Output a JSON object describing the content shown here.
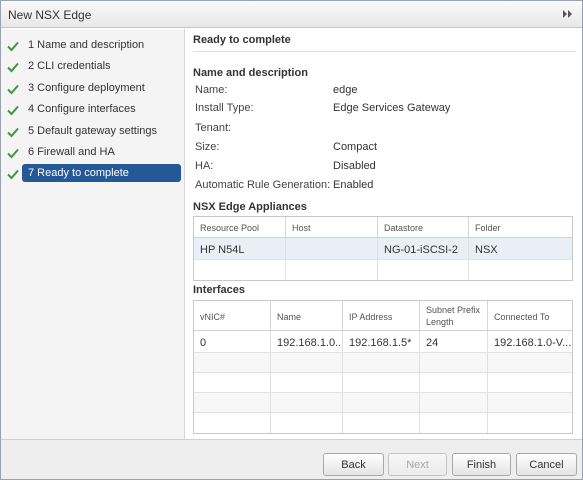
{
  "window": {
    "title": "New NSX Edge"
  },
  "steps": [
    {
      "num": "1",
      "label": "1  Name and description",
      "done": true
    },
    {
      "num": "2",
      "label": "2  CLI credentials",
      "done": true
    },
    {
      "num": "3",
      "label": "3  Configure deployment",
      "done": true
    },
    {
      "num": "4",
      "label": "4  Configure interfaces",
      "done": true
    },
    {
      "num": "5",
      "label": "5  Default gateway settings",
      "done": true
    },
    {
      "num": "6",
      "label": "6  Firewall and HA",
      "done": true
    },
    {
      "num": "7",
      "label": "7  Ready to complete",
      "done": true,
      "active": true
    }
  ],
  "content": {
    "title": "Ready to complete",
    "name_section": {
      "heading": "Name and description",
      "rows": [
        {
          "label": "Name:",
          "value": "edge"
        },
        {
          "label": "Install Type:",
          "value": "Edge Services Gateway"
        },
        {
          "label": "Tenant:",
          "value": ""
        },
        {
          "label": "Size:",
          "value": "Compact"
        },
        {
          "label": "HA:",
          "value": "Disabled"
        },
        {
          "label": "Automatic Rule Generation:",
          "value": "Enabled"
        }
      ]
    },
    "appliances": {
      "heading": "NSX Edge Appliances",
      "columns": [
        "Resource Pool",
        "Host",
        "Datastore",
        "Folder"
      ],
      "rows": [
        [
          "HP N54L",
          "",
          "NG-01-iSCSI-2",
          "NSX"
        ]
      ]
    },
    "interfaces": {
      "heading": "Interfaces",
      "columns": [
        "vNIC#",
        "Name",
        "IP Address",
        "Subnet Prefix Length",
        "Connected To"
      ],
      "rows": [
        [
          "0",
          "192.168.1.0...",
          "192.168.1.5*",
          "24",
          "192.168.1.0-V..."
        ]
      ]
    }
  },
  "footer": {
    "back": "Back",
    "next": "Next",
    "finish": "Finish",
    "cancel": "Cancel"
  },
  "colors": {
    "accent": "#245896",
    "check": "#3a9a3a"
  }
}
